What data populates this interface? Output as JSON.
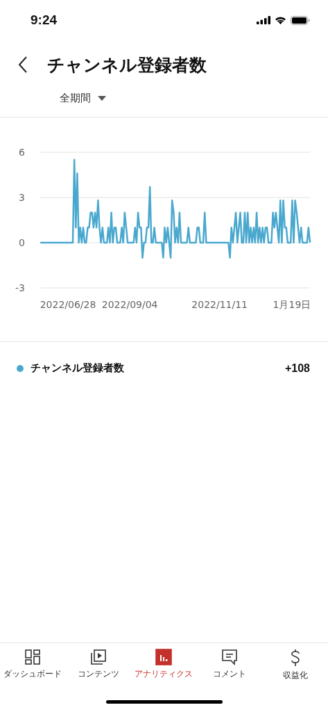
{
  "status_bar": {
    "time": "9:24"
  },
  "header": {
    "title": "チャンネル登録者数",
    "period": "全期間"
  },
  "chart": {
    "x_axis_labels": [
      "2022/06/28",
      "2022/09/04",
      "2022/11/11",
      "1月19日"
    ],
    "chart_data": {
      "type": "line",
      "ylim": [
        -3,
        6
      ],
      "yticks": [
        -3,
        0,
        3,
        6
      ],
      "series": [
        {
          "name": "チャンネル登録者数",
          "color": "#4aa8cf",
          "values": [
            0,
            0,
            0,
            0,
            0,
            0,
            0,
            0,
            0,
            0,
            0,
            0,
            0,
            0,
            0,
            0,
            0,
            0,
            0,
            0,
            0,
            0,
            0,
            5.5,
            1,
            4.6,
            0,
            1,
            0,
            1,
            0,
            0,
            1,
            1,
            2,
            2,
            1,
            2,
            1,
            2.8,
            1,
            0,
            1,
            0,
            0,
            0,
            1,
            0,
            2,
            0,
            1,
            1,
            0,
            0,
            0,
            1,
            0,
            2,
            1,
            0,
            0,
            0,
            0,
            0,
            1,
            0,
            2,
            1,
            1,
            -1,
            0,
            0,
            1,
            1,
            3.7,
            0,
            0,
            1,
            0,
            0,
            0,
            0,
            0,
            -1,
            1,
            0,
            1,
            0,
            -1,
            2.8,
            2,
            0,
            1,
            0,
            2,
            0,
            0,
            0,
            0,
            0,
            1,
            0,
            0,
            0,
            0,
            0,
            1,
            1,
            0,
            0,
            0,
            2,
            0,
            0,
            0,
            0,
            0,
            0,
            0,
            0,
            0,
            0,
            0,
            0,
            0,
            0,
            0,
            0,
            -1,
            1,
            0,
            1,
            2,
            0,
            1,
            2,
            0,
            0,
            2,
            0,
            2,
            0,
            1,
            0,
            1,
            0,
            2,
            0,
            1,
            0,
            1,
            0,
            1,
            1,
            0,
            0,
            0,
            2,
            1,
            2,
            1,
            0,
            2.8,
            0,
            2.8,
            1,
            1,
            0,
            0,
            0,
            2.8,
            0,
            2.8,
            2,
            1,
            0,
            1,
            0,
            0,
            0,
            0,
            1,
            0
          ]
        }
      ]
    }
  },
  "legend": [
    {
      "value": "+108"
    }
  ],
  "nav": [
    {
      "label": "ダッシュボード",
      "selected": false
    },
    {
      "label": "コンテンツ",
      "selected": false
    },
    {
      "label": "アナリティクス",
      "selected": true
    },
    {
      "label": "コメント",
      "selected": false
    },
    {
      "label": "収益化",
      "selected": false
    }
  ]
}
